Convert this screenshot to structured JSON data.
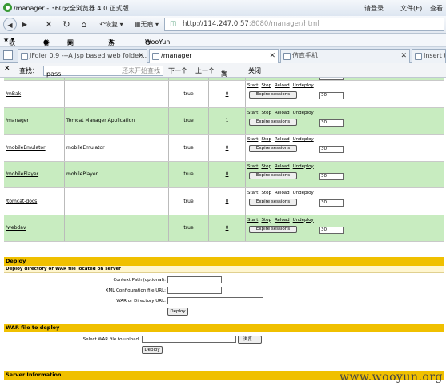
{
  "window": {
    "title": "/manager - 360安全浏览器 4.0 正式版",
    "login": "请登录",
    "menu_file": "文件(E)",
    "menu_view": "查看"
  },
  "nav": {
    "restore_label": "恢复",
    "noimage_label": "无痕",
    "url_host": "http://114.247.0.57",
    "url_rest": ":8080/manager/html"
  },
  "favorites": {
    "items": [
      "收藏",
      "谷歌",
      "网址大全",
      "游戏中心",
      "WooYun"
    ]
  },
  "tabs": [
    {
      "label": "JFoler 0.9 ---A jsp based web folder..."
    },
    {
      "label": "/manager"
    },
    {
      "label": "仿真手机"
    },
    {
      "label": "Insert ti"
    }
  ],
  "find": {
    "label": "查找：",
    "value": "pass",
    "status": "还未开始查找",
    "next": "下一个",
    "prev": "上一个",
    "highlight": "高亮",
    "close": "关闭"
  },
  "apps": {
    "commands": [
      "Start",
      "Stop",
      "Reload",
      "Undeploy"
    ],
    "expire_label": "Expire sessions",
    "rows": [
      {
        "path": "/mBak",
        "display": "",
        "running": "true",
        "sessions": "0",
        "timeout": "30"
      },
      {
        "path": "/manager",
        "display": "Tomcat Manager Application",
        "running": "true",
        "sessions": "1",
        "timeout": "30"
      },
      {
        "path": "/mobileEmulator",
        "display": "mobileEmulator",
        "running": "true",
        "sessions": "0",
        "timeout": "30"
      },
      {
        "path": "/mobilePlayer",
        "display": "mobilePlayer",
        "running": "true",
        "sessions": "0",
        "timeout": "30"
      },
      {
        "path": "/tomcat-docs",
        "display": "",
        "running": "true",
        "sessions": "0",
        "timeout": "30"
      },
      {
        "path": "/webdav",
        "display": "",
        "running": "true",
        "sessions": "0",
        "timeout": "30"
      }
    ]
  },
  "deploy": {
    "title": "Deploy",
    "subtitle": "Deploy directory or WAR file located on server",
    "context_label": "Context Path (optional):",
    "xml_label": "XML Configuration file URL:",
    "war_label": "WAR or Directory URL:",
    "deploy_button": "Deploy"
  },
  "warfile": {
    "title": "WAR file to deploy",
    "select_label": "Select WAR file to upload",
    "browse_button": "浏览...",
    "deploy_button": "Deploy"
  },
  "next_section": "Server Information",
  "watermark": "www.wooyun.org",
  "colors": {
    "green_row": "#c8ecc0",
    "section_header": "#f0c000"
  }
}
